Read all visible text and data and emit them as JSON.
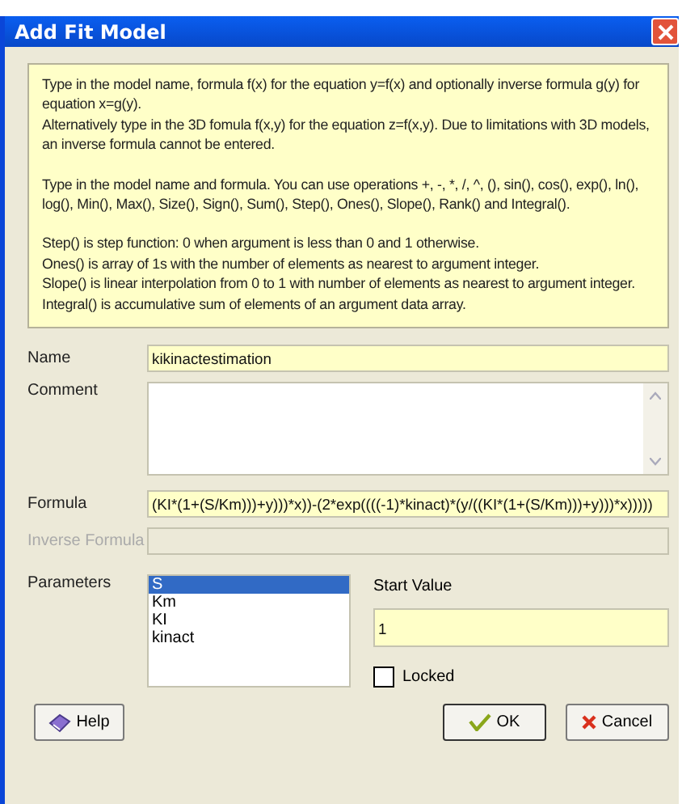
{
  "window": {
    "title": "Add Fit Model"
  },
  "info": {
    "paragraphs": [
      "Type in the model name, formula f(x) for the equation y=f(x) and optionally inverse formula g(y) for equation x=g(y).\nAlternatively type in the 3D fomula f(x,y) for the equation z=f(x,y). Due to limitations with 3D models, an inverse formula cannot be entered.",
      "Type in the model name and formula. You can use operations +, -, *, /, ^, (), sin(), cos(), exp(), ln(), log(), Min(), Max(), Size(), Sign(), Sum(), Step(), Ones(), Slope(), Rank() and Integral().",
      "Step() is step function: 0 when argument is less than 0 and 1 otherwise.\nOnes() is array of 1s with the number of elements as nearest to argument integer.\nSlope() is linear interpolation from 0 to 1 with number of elements as nearest to argument integer.\nIntegral() is accumulative sum of elements of an argument data array."
    ]
  },
  "fields": [
    {
      "kind": "text",
      "label": "Name",
      "value": "kikinactestimation",
      "disabled": false
    },
    {
      "kind": "textarea",
      "label": "Comment",
      "disabled": false
    },
    {
      "kind": "text",
      "label": "Formula",
      "value": "(KI*(1+(S/Km)))+y)))*x))-(2*exp((((-1)*kinact)*(y/((KI*(1+(S/Km)))+y)))*x)))))",
      "disabled": false
    },
    {
      "kind": "text",
      "label": "Inverse Formula",
      "disabled": true
    }
  ],
  "parameters": {
    "label": "Parameters",
    "items": [
      {
        "label": "S",
        "selected": true
      },
      {
        "label": "Km",
        "selected": false
      },
      {
        "label": "KI",
        "selected": false
      },
      {
        "label": "kinact",
        "selected": false
      }
    ],
    "start_value": {
      "label": "Start Value",
      "value": "1"
    },
    "locked": {
      "label": "Locked",
      "checked": false
    }
  },
  "buttons": [
    {
      "kind": "help",
      "label": "Help"
    },
    {
      "kind": "ok",
      "label": "OK"
    },
    {
      "kind": "cancel",
      "label": "Cancel"
    }
  ]
}
